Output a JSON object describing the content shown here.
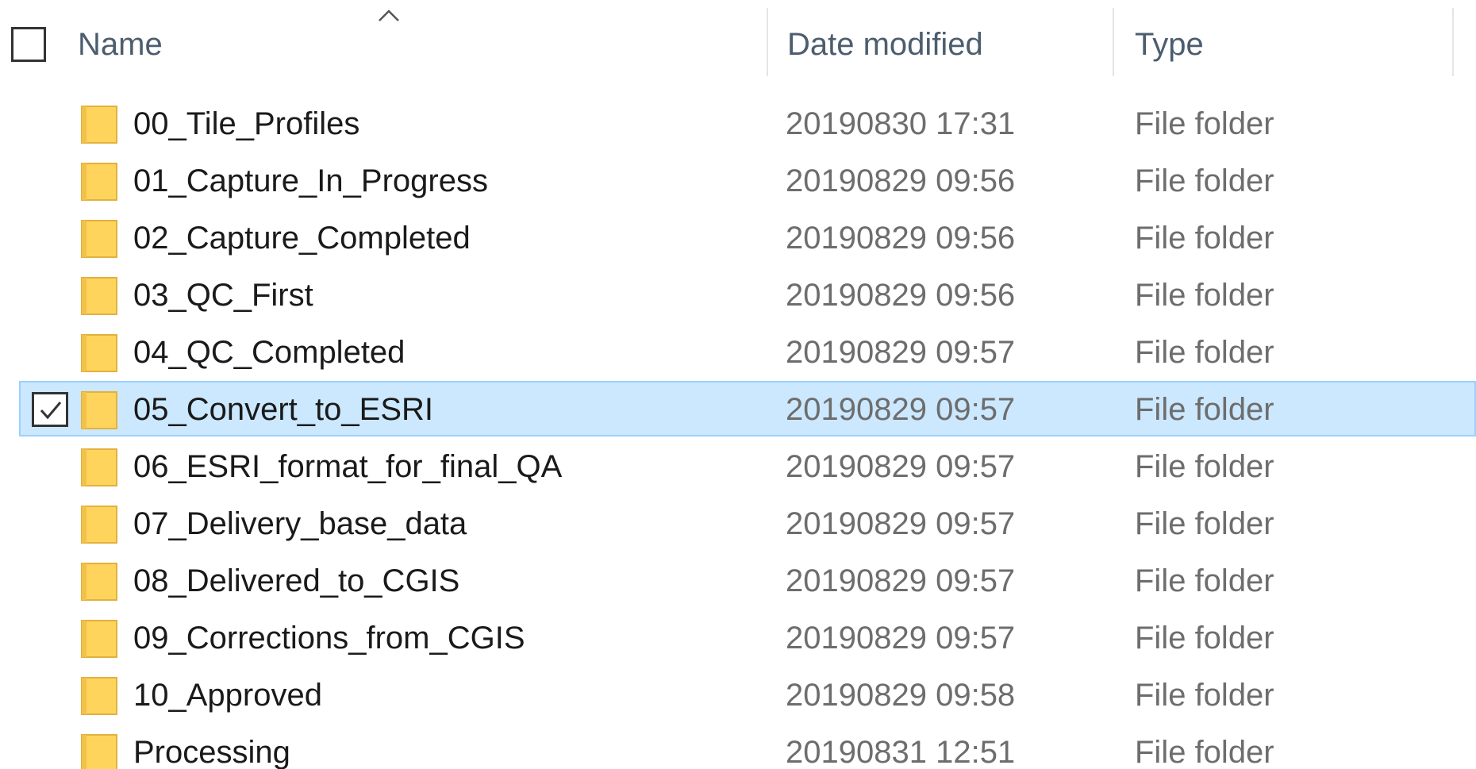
{
  "header": {
    "name_label": "Name",
    "date_label": "Date modified",
    "type_label": "Type",
    "sort_icon": "chevron-up-icon"
  },
  "colors": {
    "selection_fill": "#cce8ff",
    "selection_border": "#99d1ff",
    "folder_yellow": "#ffd45c",
    "header_text": "#4c5d6e"
  },
  "rows": [
    {
      "name": "00_Tile_Profiles",
      "date": "20190830 17:31",
      "type": "File folder",
      "selected": false
    },
    {
      "name": "01_Capture_In_Progress",
      "date": "20190829 09:56",
      "type": "File folder",
      "selected": false
    },
    {
      "name": "02_Capture_Completed",
      "date": "20190829 09:56",
      "type": "File folder",
      "selected": false
    },
    {
      "name": "03_QC_First",
      "date": "20190829 09:56",
      "type": "File folder",
      "selected": false
    },
    {
      "name": "04_QC_Completed",
      "date": "20190829 09:57",
      "type": "File folder",
      "selected": false
    },
    {
      "name": "05_Convert_to_ESRI",
      "date": "20190829 09:57",
      "type": "File folder",
      "selected": true
    },
    {
      "name": "06_ESRI_format_for_final_QA",
      "date": "20190829 09:57",
      "type": "File folder",
      "selected": false
    },
    {
      "name": "07_Delivery_base_data",
      "date": "20190829 09:57",
      "type": "File folder",
      "selected": false
    },
    {
      "name": "08_Delivered_to_CGIS",
      "date": "20190829 09:57",
      "type": "File folder",
      "selected": false
    },
    {
      "name": "09_Corrections_from_CGIS",
      "date": "20190829 09:57",
      "type": "File folder",
      "selected": false
    },
    {
      "name": "10_Approved",
      "date": "20190829 09:58",
      "type": "File folder",
      "selected": false
    },
    {
      "name": "Processing",
      "date": "20190831 12:51",
      "type": "File folder",
      "selected": false
    }
  ]
}
